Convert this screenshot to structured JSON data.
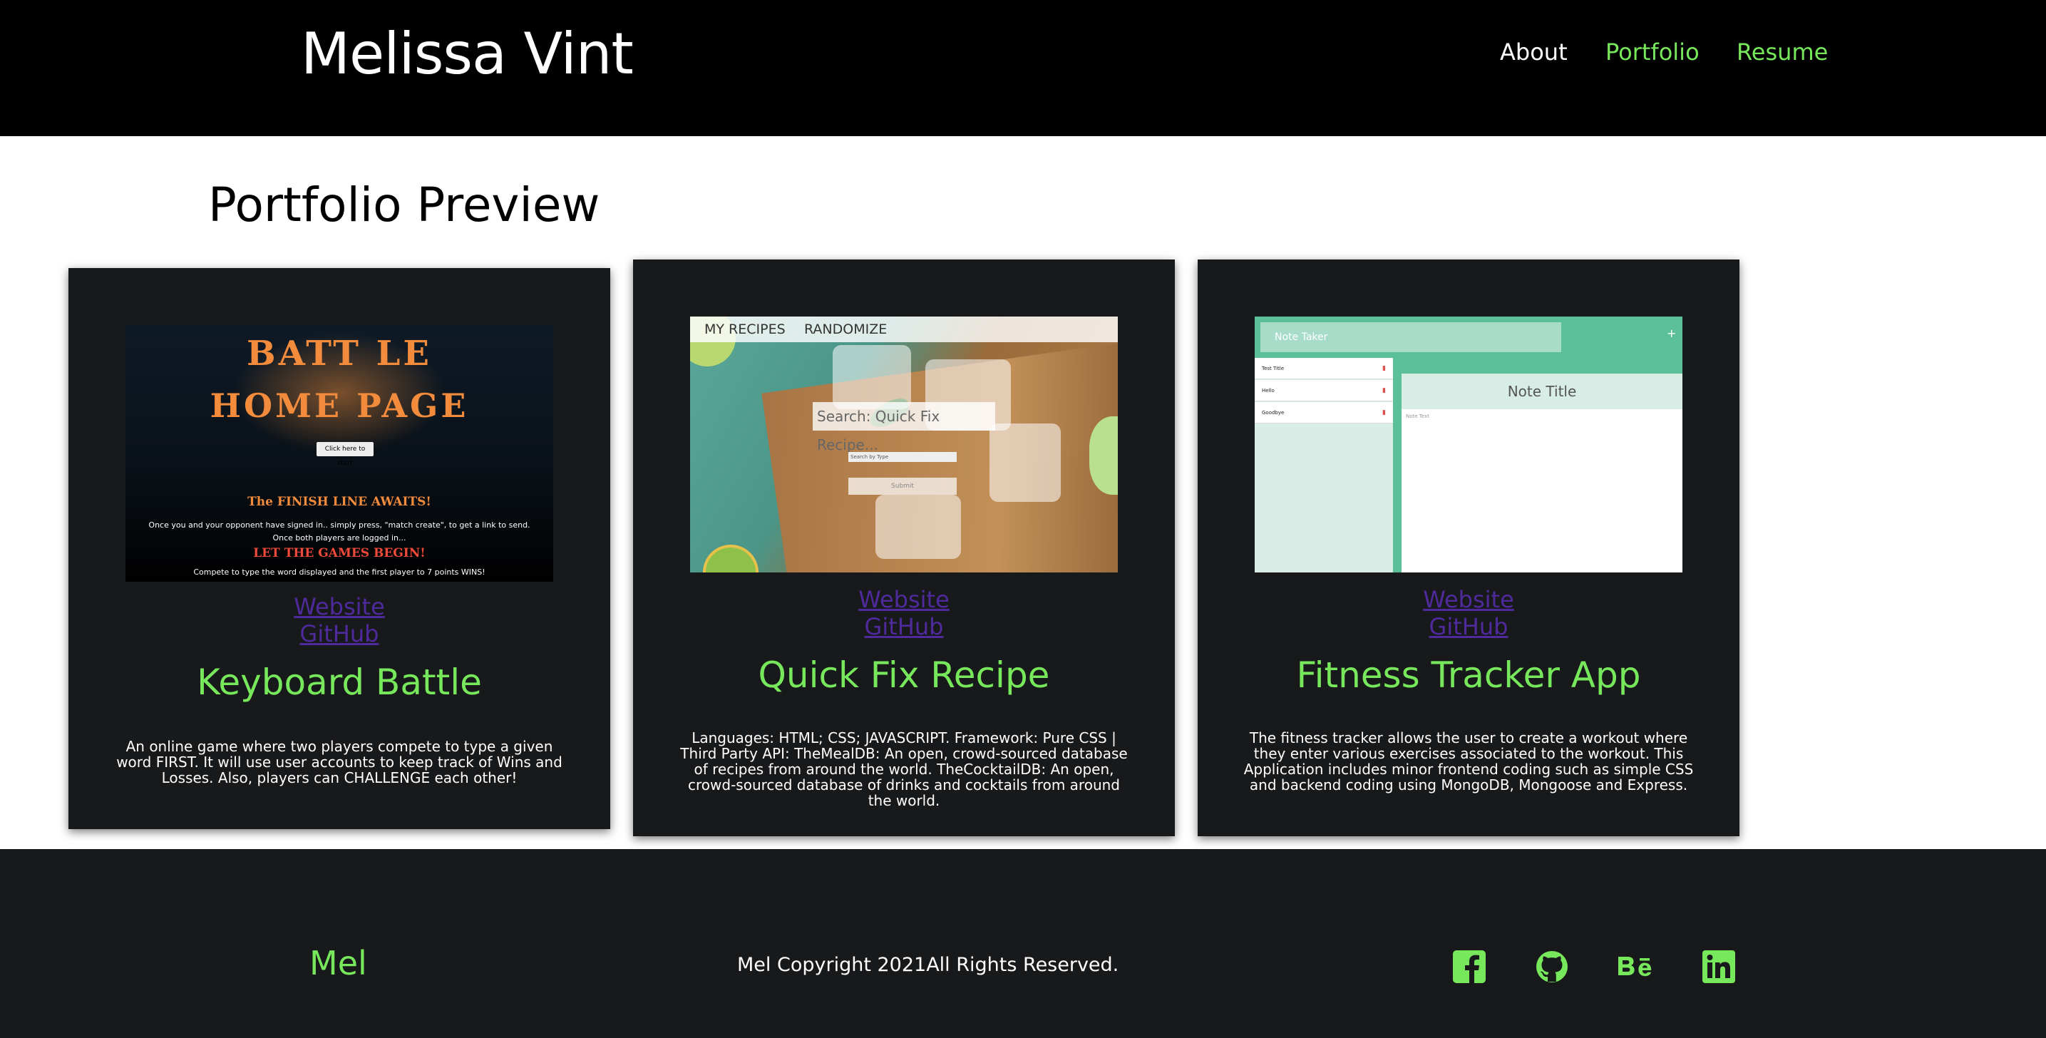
{
  "header": {
    "site_title": "Melissa Vint",
    "nav": [
      {
        "label": "About",
        "color": "#ffffff"
      },
      {
        "label": "Portfolio",
        "color": "#77e85b"
      },
      {
        "label": "Resume",
        "color": "#77e85b"
      }
    ]
  },
  "main": {
    "section_title": "Portfolio Preview",
    "projects": [
      {
        "title": "Keyboard Battle",
        "website_label": "Website",
        "github_label": "GitHub",
        "description": "An online game where two players compete to type a given word FIRST. It will use user accounts to keep track of Wins and Losses. Also, players can CHALLENGE each other!",
        "screenshot": {
          "line1": "BATT LE",
          "line2": "HOME PAGE",
          "button": "Click here to start",
          "heading": "The FINISH LINE AWAITS!",
          "text1": "Once you and your opponent have signed in.. simply press, \"match create\", to get a link to send.",
          "text2": "Once both players are logged in...",
          "banner": "LET THE GAMES BEGIN!",
          "text3": "Compete to type the word displayed and the first player to 7 points WINS!"
        }
      },
      {
        "title": "Quick Fix Recipe",
        "website_label": "Website",
        "github_label": "GitHub",
        "description": "Languages: HTML; CSS; JAVASCRIPT. Framework: Pure CSS | Third Party API: TheMealDB: An open, crowd-sourced database of recipes from around the world. TheCocktailDB: An open, crowd-sourced database of drinks and cocktails from around the world.",
        "screenshot": {
          "menu1": "MY RECIPES",
          "menu2": "RANDOMIZE",
          "search_placeholder": "Search: Quick Fix Recipe...",
          "select": "Search by Type",
          "submit": "Submit"
        }
      },
      {
        "title": "Fitness Tracker App",
        "website_label": "Website",
        "github_label": "GitHub",
        "description": "The fitness tracker allows the user to create a workout where they enter various exercises associated to the workout. This Application includes minor frontend coding such as simple CSS and backend coding using MongoDB, Mongoose and Express.",
        "screenshot": {
          "app_title": "Note Taker",
          "plus": "+",
          "notes": [
            "Test Title",
            "Hello",
            "Goodbye"
          ],
          "note_title": "Note Title",
          "note_text": "Note Text"
        }
      }
    ]
  },
  "footer": {
    "brand": "Mel",
    "copyright": "Mel Copyright 2021All Rights Reserved.",
    "social_icons": [
      "facebook-icon",
      "github-icon",
      "behance-icon",
      "linkedin-icon"
    ],
    "accent": "#77e85b"
  }
}
